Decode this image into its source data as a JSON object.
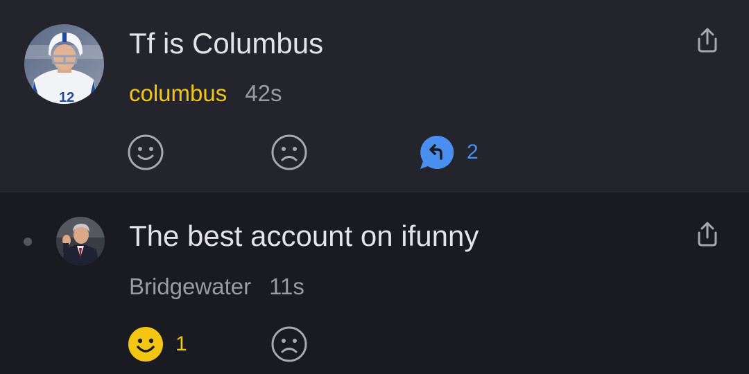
{
  "comments": [
    {
      "text": "Tf is Columbus",
      "author": "columbus",
      "time": "42s",
      "author_color": "#f4c614",
      "reply_count": "2",
      "like_count": "",
      "avatar": "football-player-avatar",
      "liked": false
    },
    {
      "text": "The best account on ifunny",
      "author": "Bridgewater",
      "time": "11s",
      "author_color": "#9a9ba3",
      "like_count": "1",
      "avatar": "man-in-suit-avatar",
      "liked": true
    }
  ],
  "icons": {
    "like": "smile-icon",
    "dislike": "frown-icon",
    "reply": "reply-bubble-icon",
    "share": "share-icon"
  },
  "colors": {
    "background": "#1a1b20",
    "highlight_background": "#24252c",
    "accent_yellow": "#f4c614",
    "accent_blue": "#4a8ff0"
  }
}
